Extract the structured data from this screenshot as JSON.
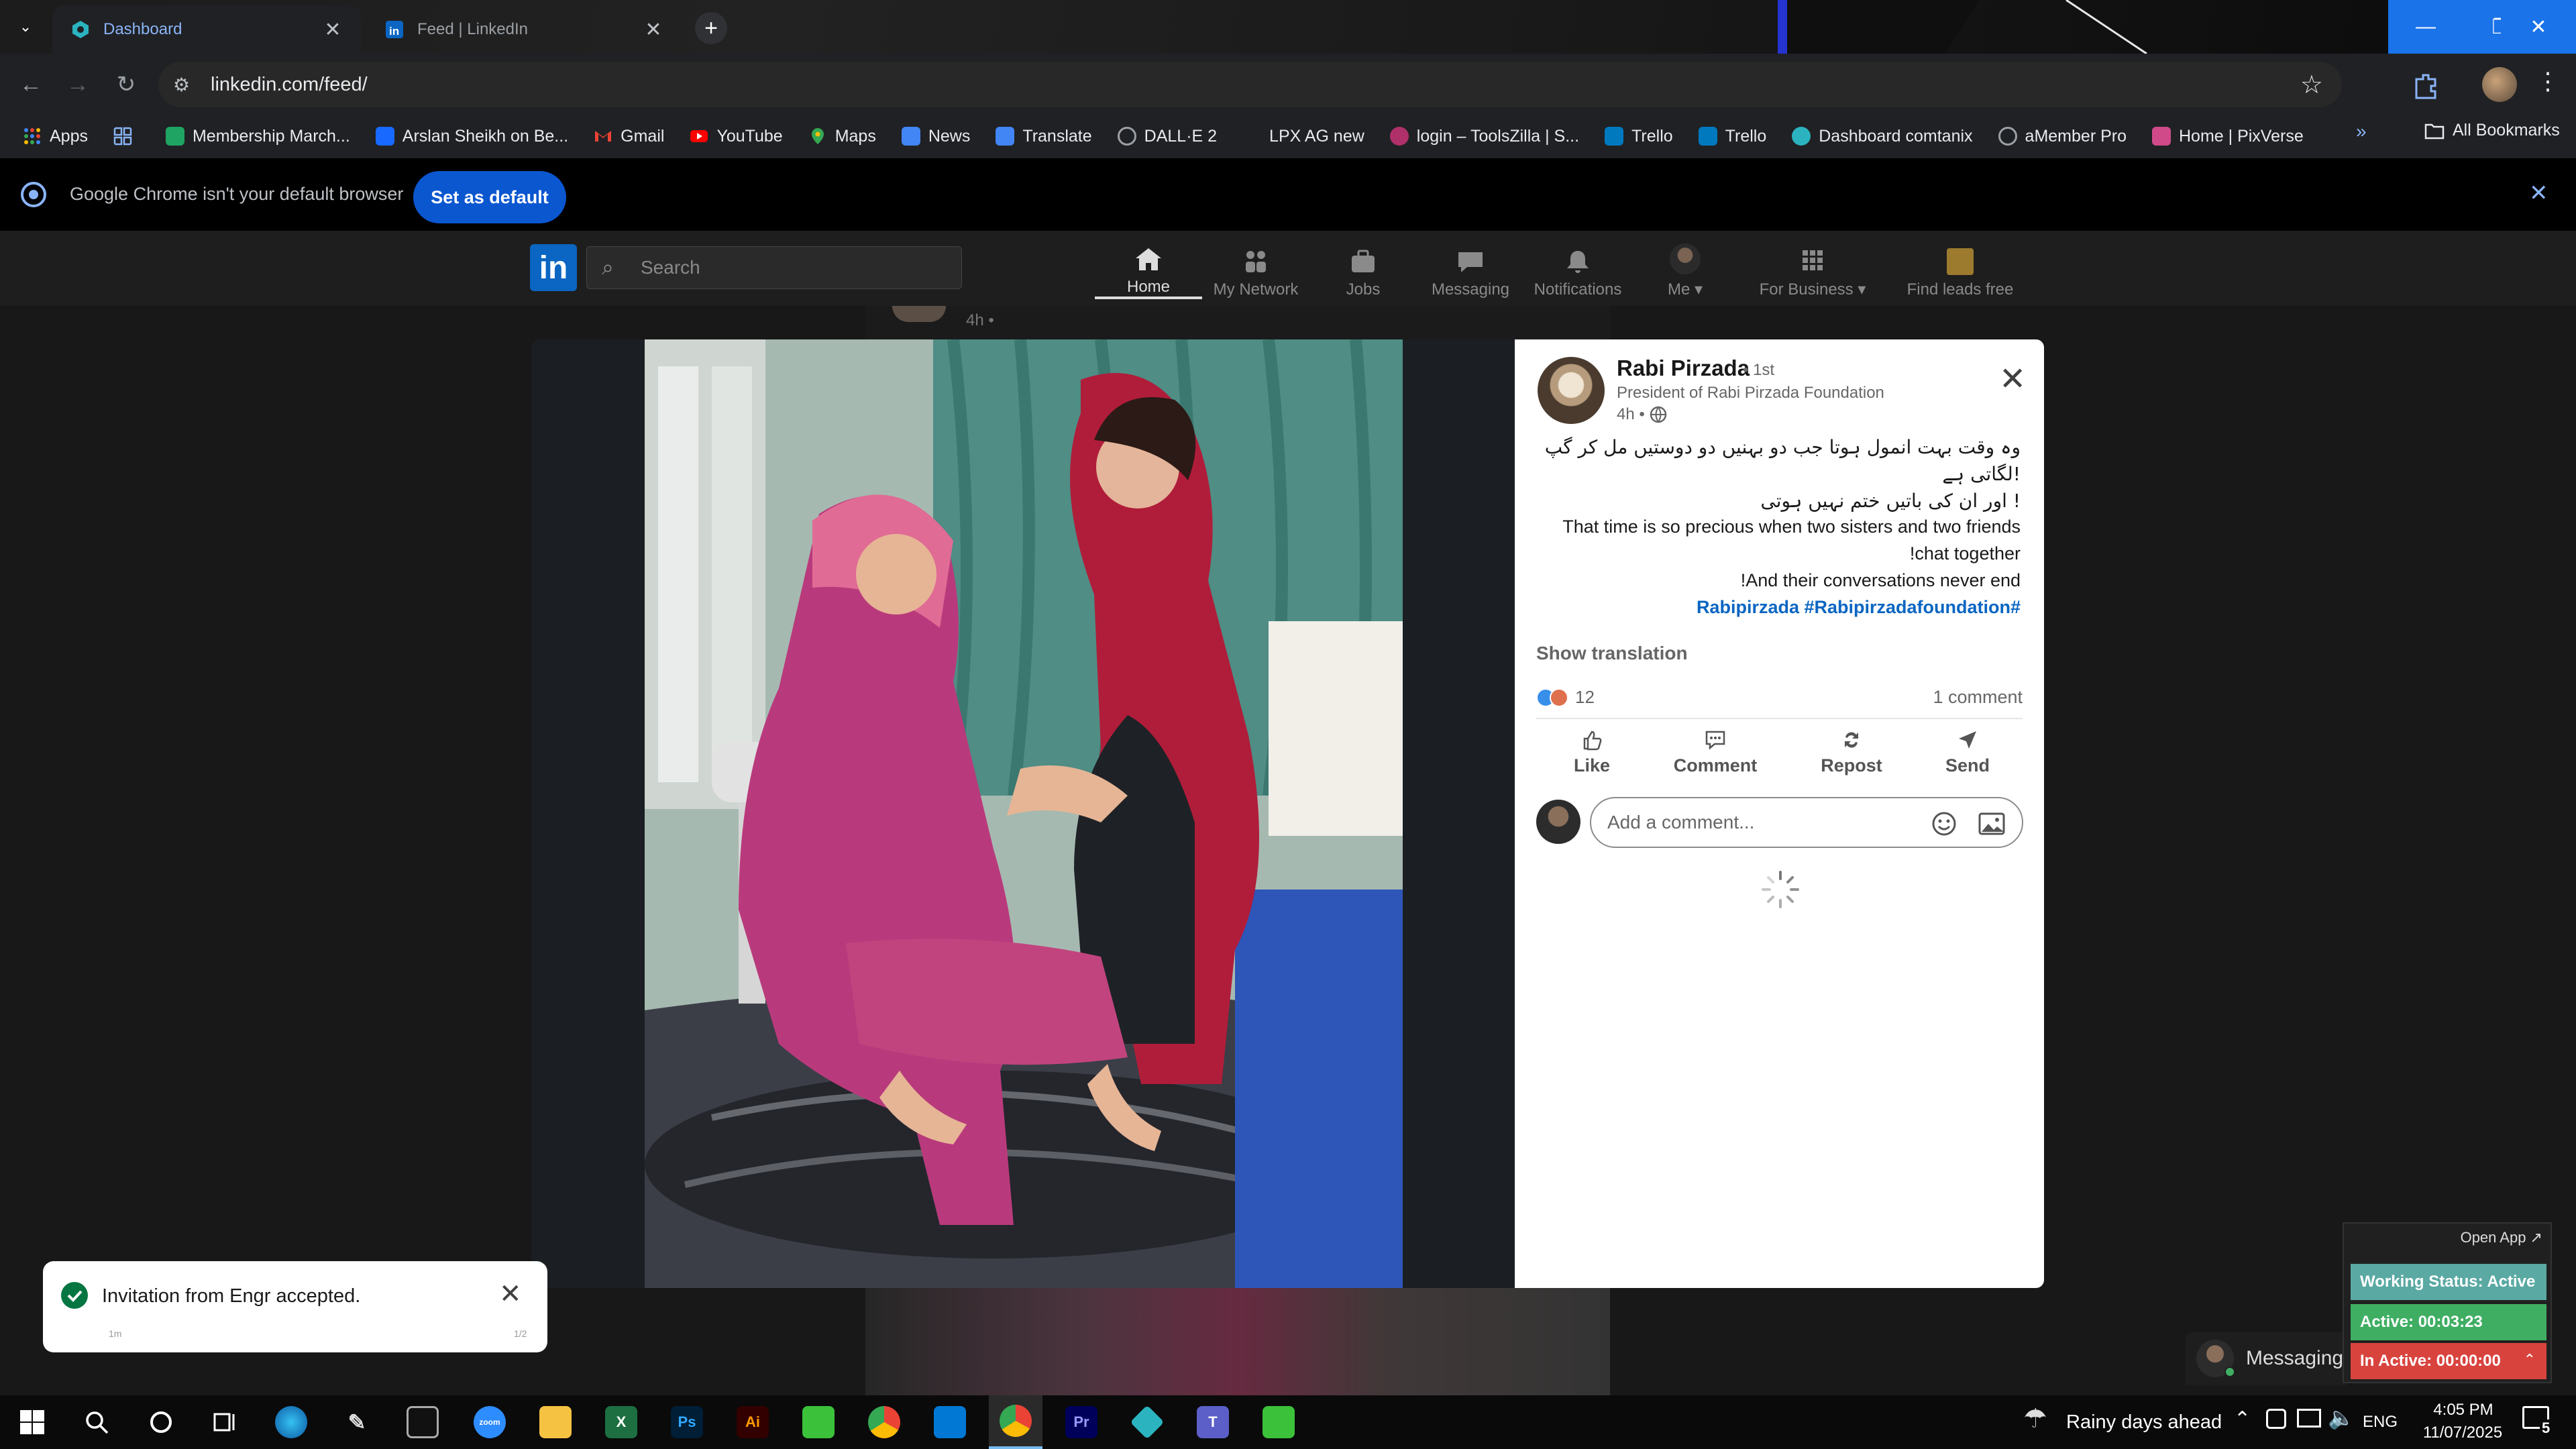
{
  "browser": {
    "tabs": [
      {
        "label": "Dashboard",
        "active": true
      },
      {
        "label": "Feed | LinkedIn",
        "active": false
      }
    ],
    "url": "linkedin.com/feed/",
    "bookmarks": [
      {
        "label": "Apps",
        "color": "#e8eaed"
      },
      {
        "label": "",
        "color": "#8ab4f8"
      },
      {
        "label": "Membership March...",
        "color": "#1fa463"
      },
      {
        "label": "Arslan Sheikh on Be...",
        "color": "#1769ff"
      },
      {
        "label": "Gmail",
        "color": "#ea4335"
      },
      {
        "label": "YouTube",
        "color": "#ff0000"
      },
      {
        "label": "Maps",
        "color": "#34a853"
      },
      {
        "label": "News",
        "color": "#4285f4"
      },
      {
        "label": "Translate",
        "color": "#4285f4"
      },
      {
        "label": "DALL·E 2",
        "color": "#9aa0a6"
      },
      {
        "label": "LPX AG new",
        "color": "#202124"
      },
      {
        "label": "login – ToolsZilla | S...",
        "color": "#b0306a"
      },
      {
        "label": "Trello",
        "color": "#0079bf"
      },
      {
        "label": "Trello",
        "color": "#0079bf"
      },
      {
        "label": "Dashboard comtanix",
        "color": "#2bb3c0"
      },
      {
        "label": "aMember Pro",
        "color": "#9aa0a6"
      },
      {
        "label": "Home | PixVerse",
        "color": "#d04a8a"
      }
    ],
    "all_bookmarks": "All Bookmarks",
    "default_bar_text": "Google Chrome isn't your default browser",
    "set_default": "Set as default"
  },
  "linkedin": {
    "search_placeholder": "Search",
    "nav": [
      {
        "label": "Home",
        "icon": "home-icon"
      },
      {
        "label": "My Network",
        "icon": "network-icon"
      },
      {
        "label": "Jobs",
        "icon": "jobs-icon"
      },
      {
        "label": "Messaging",
        "icon": "messaging-icon"
      },
      {
        "label": "Notifications",
        "icon": "bell-icon"
      },
      {
        "label": "Me ▾",
        "icon": "avatar"
      },
      {
        "label": "For Business ▾",
        "icon": "grid-icon"
      },
      {
        "label": "Find leads free",
        "icon": "leads-icon"
      }
    ],
    "feed_time": "4h •"
  },
  "post": {
    "author": "Rabi Pirzada",
    "degree": "• 1st",
    "headline": "President of Rabi Pirzada Foundation",
    "time": "4h •",
    "lines": [
      "وہ وقت بہت انمول ہوتا جب دو بہنیں دو دوستیں مل کر گپ",
      "لگاتی ہے!",
      "اور ان کی باتیں ختم نہیں ہوتی !",
      "That time is so precious when two sisters and two friends",
      "!chat together",
      "!And their conversations never end"
    ],
    "hashtags": "Rabipirzada #Rabipirzadafoundation#",
    "show_translation": "Show translation",
    "reaction_count": "12",
    "comment_count": "1 comment",
    "actions": [
      "Like",
      "Comment",
      "Repost",
      "Send"
    ],
    "comment_placeholder": "Add a comment..."
  },
  "toast": {
    "message": "Invitation from Engr accepted.",
    "time": "1m",
    "page": "1/2"
  },
  "messaging_label": "Messaging",
  "tracker": {
    "open_app": "Open App ↗",
    "status": "Working Status: Active",
    "active": "Active: 00:03:23",
    "inactive": "In Active: 00:00:00",
    "colors": {
      "status": "#5aa9a3",
      "active": "#3fae63",
      "inactive": "#d9433e"
    }
  },
  "taskbar": {
    "weather": "Rainy days ahead",
    "lang": "ENG",
    "time": "4:05 PM",
    "date": "11/07/2025",
    "notifications": "5"
  }
}
